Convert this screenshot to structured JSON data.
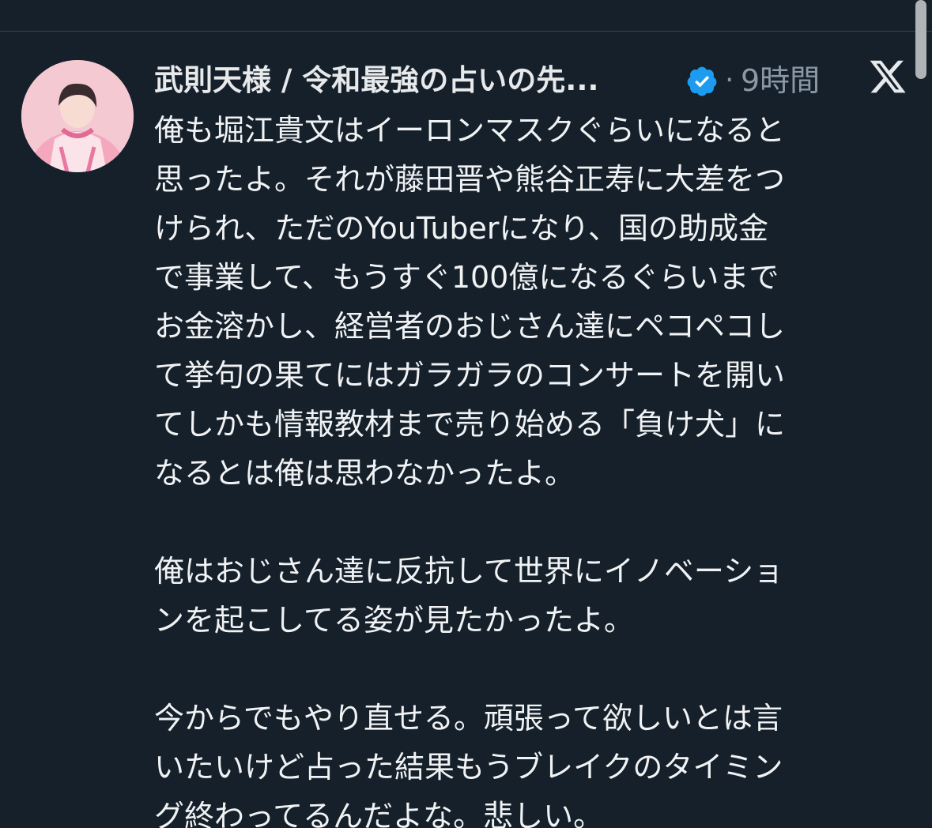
{
  "tweet": {
    "author_name": "武則天様 / 令和最強の占いの先...",
    "dot": "·",
    "time": "9時間",
    "paragraphs": [
      [
        "俺も堀江貴文はイーロンマスクぐらいになると",
        "思ったよ。それが藤田晋や熊谷正寿に大差をつ",
        "けられ、ただのYouTuberになり、国の助成金",
        "で事業して、もうすぐ100億になるぐらいまで",
        "お金溶かし、経営者のおじさん達にペコペコし",
        "て挙句の果てにはガラガラのコンサートを開い",
        "てしかも情報教材まで売り始める「負け犬」に",
        "なるとは俺は思わなかったよ。"
      ],
      [
        "俺はおじさん達に反抗して世界にイノベーショ",
        "ンを起こしてる姿が見たかったよ。"
      ],
      [
        "今からでもやり直せる。頑張って欲しいとは言",
        "いたいけど占った結果もうブレイクのタイミン",
        "グ終わってるんだよな。悲しい。"
      ]
    ]
  },
  "icons": {
    "verified": "verified-badge-icon",
    "logo": "x-logo-icon",
    "avatar": "avatar-photo"
  },
  "colors": {
    "background": "#15202b",
    "text": "#e7e9ea",
    "muted": "#8b98a5",
    "verified": "#1d9bf0"
  }
}
